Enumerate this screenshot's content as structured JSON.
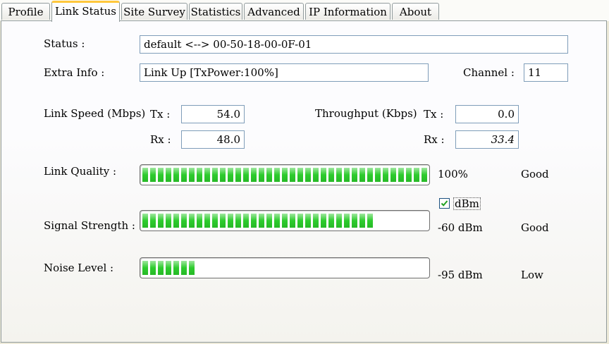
{
  "tabs": [
    {
      "label": "Profile"
    },
    {
      "label": "Link Status"
    },
    {
      "label": "Site Survey"
    },
    {
      "label": "Statistics"
    },
    {
      "label": "Advanced"
    },
    {
      "label": "IP Information"
    },
    {
      "label": "About"
    }
  ],
  "active_tab": "Link Status",
  "status": {
    "label": "Status :",
    "value": "default <--> 00-50-18-00-0F-01"
  },
  "extra_info": {
    "label": "Extra Info :",
    "value": "Link Up [TxPower:100%]"
  },
  "channel": {
    "label": "Channel :",
    "value": "11"
  },
  "link_speed": {
    "label": "Link Speed (Mbps)",
    "tx_label": "Tx :",
    "tx_value": "54.0",
    "rx_label": "Rx :",
    "rx_value": "48.0"
  },
  "throughput": {
    "label": "Throughput (Kbps)",
    "tx_label": "Tx :",
    "tx_value": "0.0",
    "rx_label": "Rx :",
    "rx_value": "33.4"
  },
  "link_quality": {
    "label": "Link Quality :",
    "value_text": "100%",
    "rating": "Good",
    "level_percent": 100
  },
  "dbm_toggle": {
    "label": "dBm",
    "checked": true
  },
  "signal_strength": {
    "label": "Signal Strength :",
    "value_text": "-60 dBm",
    "rating": "Good",
    "level_percent": 80
  },
  "noise_level": {
    "label": "Noise Level :",
    "value_text": "-95 dBm",
    "rating": "Low",
    "level_percent": 18
  },
  "colors": {
    "bar_fill": "#2ecc2e",
    "active_tab_accent": "#ffc73c",
    "field_border": "#7f9db9"
  }
}
